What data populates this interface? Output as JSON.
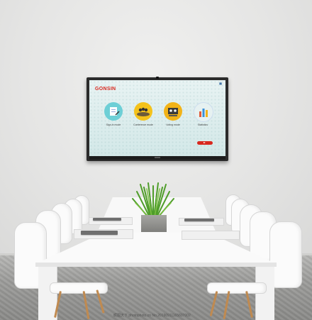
{
  "screen": {
    "brand": "GONSIN",
    "apps": [
      {
        "icon": "sign-in-icon",
        "label": "Sign-in mode",
        "color": "#6dcfd6"
      },
      {
        "icon": "meeting-icon",
        "label": "Conference mode",
        "color": "#f4c21b"
      },
      {
        "icon": "voting-icon",
        "label": "Voting mode",
        "color": "#f2b318"
      },
      {
        "icon": "statistics-icon",
        "label": "Statistics",
        "color": "#e6f1f1"
      }
    ],
    "accent": "#d8281f"
  },
  "watermark": "昵图天下 photophoto.cn  No.20190911165607002"
}
